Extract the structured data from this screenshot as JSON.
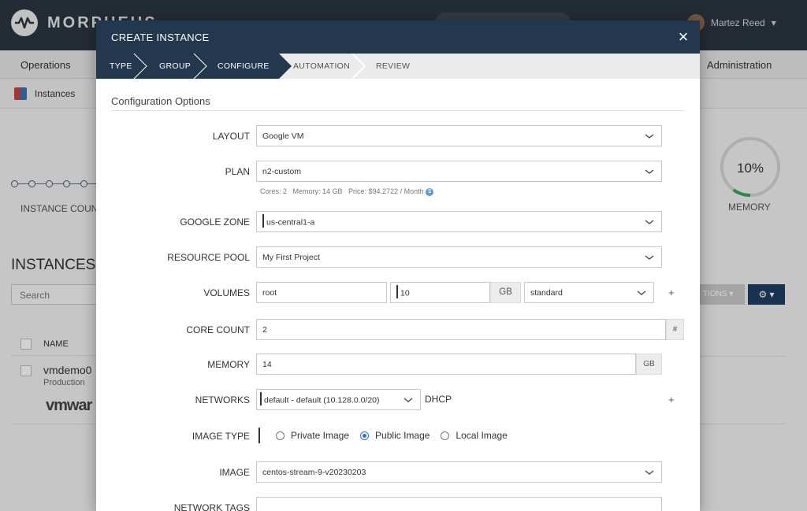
{
  "app": {
    "brand": "MORPHEUS",
    "user_name": "Martez Reed",
    "nav": {
      "operations": "Operations",
      "administration": "Administration"
    },
    "breadcrumb": "Instances",
    "instance_count_label": "INSTANCE COUN",
    "instances_title": "INSTANCES",
    "search_placeholder": "Search",
    "table": {
      "name_header": "NAME",
      "row": {
        "name": "vmdemo0",
        "environment": "Production",
        "logo": "vmwar"
      }
    },
    "memory_gauge": {
      "value": "10%",
      "label": "MEMORY",
      "fraction": 0.1,
      "color": "#3aa757"
    },
    "actions_label": "TIONS ▾",
    "gear_label": "⚙ ▾"
  },
  "modal": {
    "title": "CREATE INSTANCE",
    "close_icon": "×",
    "steps": [
      {
        "label": "TYPE",
        "state": "done"
      },
      {
        "label": "GROUP",
        "state": "done"
      },
      {
        "label": "CONFIGURE",
        "state": "active"
      },
      {
        "label": "AUTOMATION",
        "state": "pending"
      },
      {
        "label": "REVIEW",
        "state": "pending"
      }
    ],
    "section_title": "Configuration Options",
    "fields": {
      "layout": {
        "label": "LAYOUT",
        "value": "Google VM"
      },
      "plan": {
        "label": "PLAN",
        "value": "n2-custom",
        "hint": "Cores: 2   Memory: 14 GB   Price: $94.2722 / Month",
        "info_icon": "$"
      },
      "google_zone": {
        "label": "GOOGLE ZONE",
        "value": "us-central1-a"
      },
      "resource_pool": {
        "label": "RESOURCE POOL",
        "value": "My First Project"
      },
      "volumes": {
        "label": "VOLUMES",
        "name": "root",
        "size": "10",
        "unit": "GB",
        "type": "standard",
        "add": "+"
      },
      "core_count": {
        "label": "CORE COUNT",
        "value": "2",
        "addon": "#"
      },
      "memory": {
        "label": "MEMORY",
        "value": "14",
        "unit": "GB"
      },
      "networks": {
        "label": "NETWORKS",
        "value": "default - default (10.128.0.0/20)",
        "dhcp": "DHCP",
        "add": "+"
      },
      "image_type": {
        "label": "IMAGE TYPE",
        "options": [
          "Private Image",
          "Public Image",
          "Local Image"
        ],
        "selected": "Public Image"
      },
      "image": {
        "label": "IMAGE",
        "value": "centos-stream-9-v20230203"
      },
      "network_tags": {
        "label": "NETWORK TAGS",
        "value": ""
      }
    },
    "colors": {
      "header": "#23384f",
      "step_active": "#23384f",
      "accent": "#2c73d2"
    }
  }
}
